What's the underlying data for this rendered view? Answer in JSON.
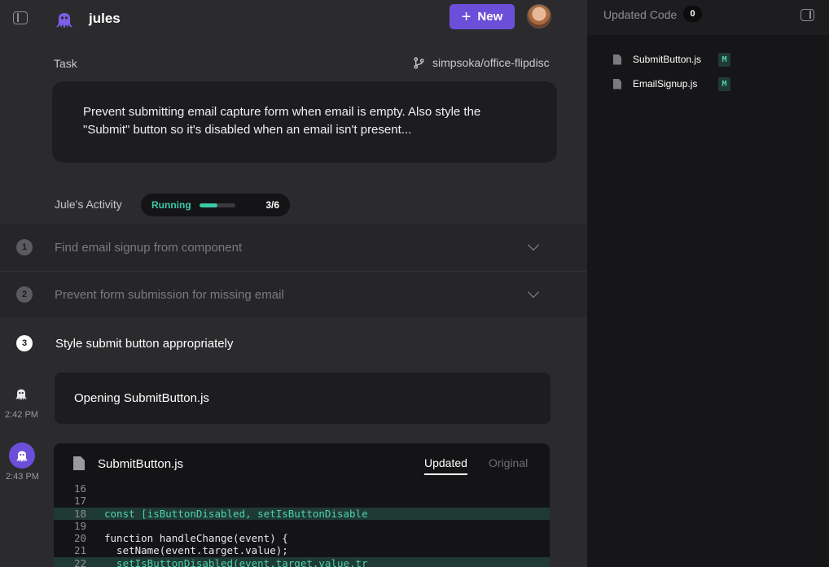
{
  "header": {
    "brand": "jules",
    "new_button_label": "New"
  },
  "task": {
    "label": "Task",
    "repo": "simpsoka/office-flipdisc",
    "description": "Prevent submitting email capture form when email is empty. Also style the \"Submit\" button so it's disabled when an email isn't present..."
  },
  "activity": {
    "label": "Jule's Activity",
    "status": "Running",
    "progress_fraction": 0.5,
    "count": "3/6"
  },
  "steps": [
    {
      "number": "1",
      "title": "Find email signup from component"
    },
    {
      "number": "2",
      "title": "Prevent form submission for missing email"
    },
    {
      "number": "3",
      "title": "Style submit button appropriately"
    }
  ],
  "messages": [
    {
      "time": "2:42 PM",
      "text": "Opening SubmitButton.js"
    },
    {
      "time": "2:43 PM"
    }
  ],
  "code_view": {
    "file": "SubmitButton.js",
    "tab_updated": "Updated",
    "tab_original": "Original",
    "lines": [
      {
        "n": "16",
        "code": "",
        "added": false
      },
      {
        "n": "17",
        "code": "",
        "added": false
      },
      {
        "n": "18",
        "code": "const [isButtonDisabled, setIsButtonDisable",
        "added": true
      },
      {
        "n": "19",
        "code": "",
        "added": false
      },
      {
        "n": "20",
        "code": "function handleChange(event) {",
        "added": false
      },
      {
        "n": "21",
        "code": "  setName(event.target.value);",
        "added": false
      },
      {
        "n": "22",
        "code": "  setIsButtonDisabled(event.target.value.tr",
        "added": true
      }
    ]
  },
  "updated_code": {
    "title": "Updated Code",
    "count": "0",
    "files": [
      {
        "name": "SubmitButton.js",
        "badge": "M"
      },
      {
        "name": "EmailSignup.js",
        "badge": "M"
      }
    ]
  },
  "colors": {
    "accent": "#6b4fd8",
    "success": "#3cc9a5",
    "background": "#2b2b2e",
    "panel": "#161618"
  }
}
